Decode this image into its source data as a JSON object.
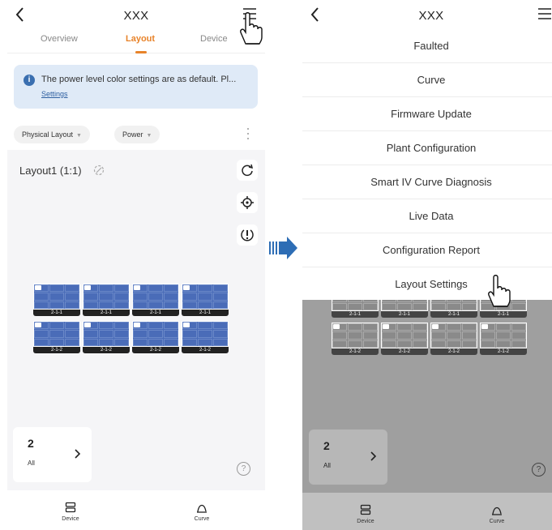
{
  "app": {
    "title": "XXX"
  },
  "tabs": [
    {
      "label": "Overview"
    },
    {
      "label": "Layout"
    },
    {
      "label": "Device"
    }
  ],
  "banner": {
    "text": "The power level color settings are as default. Pl...",
    "link": "Settings"
  },
  "filters": {
    "layout_type": "Physical Layout",
    "metric": "Power"
  },
  "canvas": {
    "layout_name": "Layout1 (1:1)",
    "rows": [
      {
        "label": "2-1-1",
        "modules": 4
      },
      {
        "label": "2-1-2",
        "modules": 4
      }
    ]
  },
  "summary": {
    "count": "2",
    "label": "All"
  },
  "bottom_nav": [
    {
      "label": "Device",
      "icon": "device-icon"
    },
    {
      "label": "Curve",
      "icon": "curve-icon"
    }
  ],
  "menu": {
    "items": [
      {
        "label": "Faulted"
      },
      {
        "label": "Curve"
      },
      {
        "label": "Firmware Update"
      },
      {
        "label": "Plant Configuration"
      },
      {
        "label": "Smart IV Curve Diagnosis"
      },
      {
        "label": "Live Data"
      },
      {
        "label": "Configuration Report"
      },
      {
        "label": "Layout Settings"
      }
    ]
  },
  "colors": {
    "accent": "#e8832a",
    "banner_bg": "#dfeaf7",
    "module_blue": "#4a6cb8",
    "arrow_blue": "#2d6db5"
  }
}
